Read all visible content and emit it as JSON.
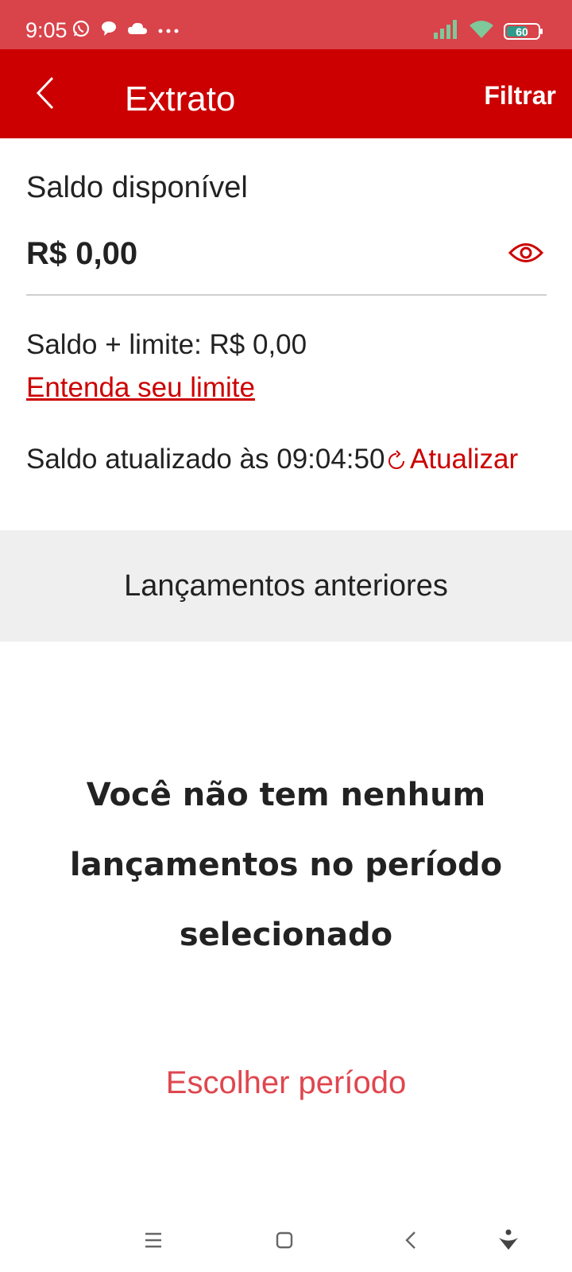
{
  "status_bar": {
    "time": "9:05",
    "left_icons": [
      "whatsapp-icon",
      "message-icon",
      "cloud-icon",
      "more-dots-icon"
    ],
    "right_icons": [
      "signal-icon",
      "wifi-icon",
      "battery-icon"
    ],
    "battery_level": "60",
    "background": "#d9434a"
  },
  "app_bar": {
    "title": "Extrato",
    "back_icon": "chevron-left-icon",
    "filter_label": "Filtrar",
    "background": "#cc0000"
  },
  "balance": {
    "label": "Saldo disponível",
    "value": "R$ 0,00",
    "visibility_icon": "eye-icon"
  },
  "limit": {
    "text": "Saldo + limite: R$ 0,00",
    "link_label": "Entenda seu limite"
  },
  "update": {
    "text": "Saldo atualizado às 09:04:50",
    "refresh_icon": "refresh-icon",
    "refresh_label": "Atualizar"
  },
  "section": {
    "title": "Lançamentos anteriores"
  },
  "empty_state": {
    "message": "Você não tem nenhum lançamentos no período selecionado",
    "action_label": "Escolher período"
  },
  "nav_bar": {
    "items": [
      "menu-icon",
      "home-square-icon",
      "back-icon",
      "assistant-icon"
    ]
  },
  "colors": {
    "accent": "#cc0000",
    "link": "#cc0000",
    "action": "#e0464e",
    "section_bg": "#efefef"
  }
}
